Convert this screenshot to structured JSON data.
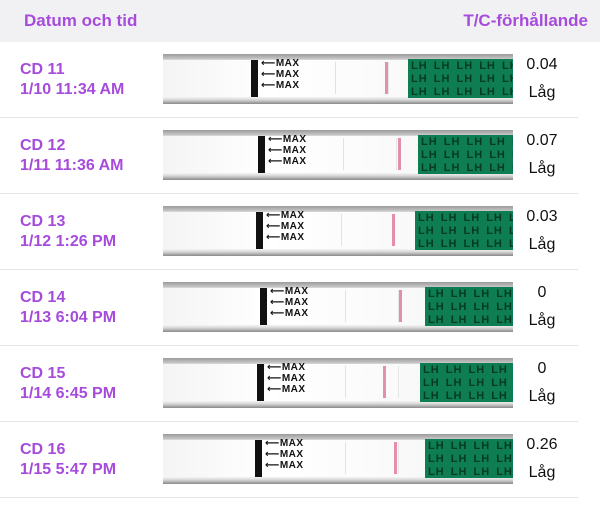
{
  "header": {
    "left_label": "Datum och tid",
    "right_label": "T/C-förhållande"
  },
  "colors": {
    "accent": "#a64bdc",
    "green_pad": "#0e7d52",
    "test_line": "#e07aa0"
  },
  "strip_text": {
    "arrow": "⟵",
    "max": "MAX",
    "lh": "LH"
  },
  "rows": [
    {
      "cd": "CD 11",
      "datetime": "1/10 11:34 AM",
      "ratio": "0.04",
      "level": "Låg"
    },
    {
      "cd": "CD 12",
      "datetime": "1/11 11:36 AM",
      "ratio": "0.07",
      "level": "Låg"
    },
    {
      "cd": "CD 13",
      "datetime": "1/12 1:26 PM",
      "ratio": "0.03",
      "level": "Låg"
    },
    {
      "cd": "CD 14",
      "datetime": "1/13 6:04 PM",
      "ratio": "0",
      "level": "Låg"
    },
    {
      "cd": "CD 15",
      "datetime": "1/14 6:45 PM",
      "ratio": "0",
      "level": "Låg"
    },
    {
      "cd": "CD 16",
      "datetime": "1/15 5:47 PM",
      "ratio": "0.26",
      "level": "Låg"
    }
  ]
}
